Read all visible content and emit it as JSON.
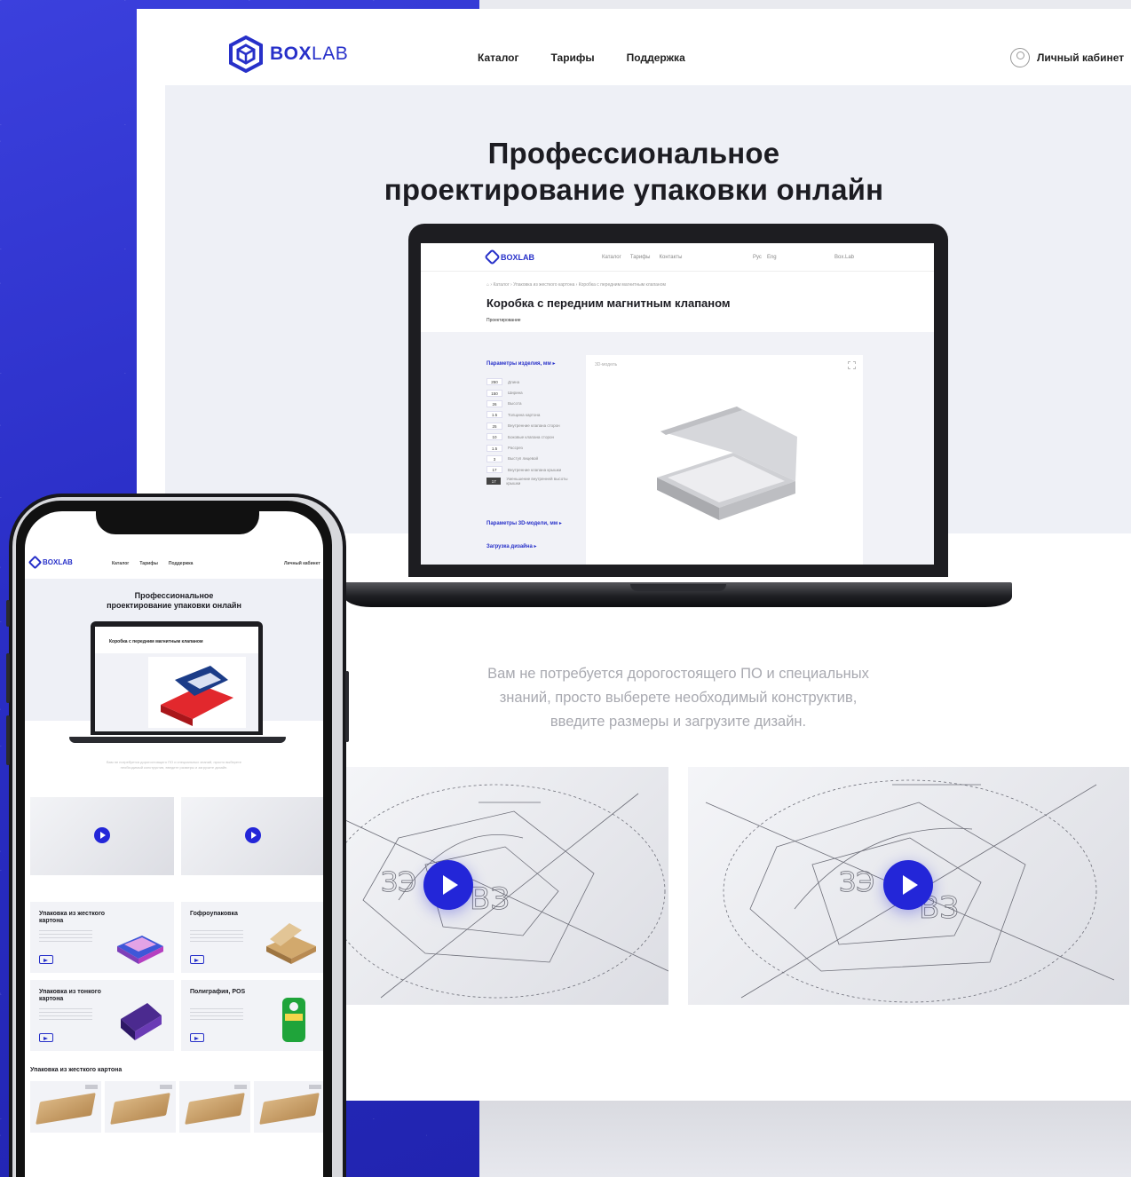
{
  "desktop": {
    "logo": {
      "bold": "BOX",
      "light": "LAB"
    },
    "nav": [
      "Каталог",
      "Тарифы",
      "Поддержка"
    ],
    "account_label": "Личный кабинет",
    "hero_title": "Профессиональное\nпроектирование упаковки онлайн",
    "description": "Вам не потребуется дорогостоящего ПО и специальных\nзнаний, просто выберете необходимый конструктив,\nвведите размеры и загрузите дизайн."
  },
  "laptop_screen": {
    "logo": "BOXLAB",
    "nav": [
      "Каталог",
      "Тарифы",
      "Контакты"
    ],
    "lang": [
      "Рус",
      "Eng"
    ],
    "user": "Box.Lab",
    "breadcrumbs": "⌂  ›  Каталог  ›  Упаковка из жесткого картона  ›  Коробка с передним магнитным клапаном",
    "product_title": "Коробка с передним магнитным клапаном",
    "subtitle": "Проектирование",
    "params_heading": "Параметры изделия, мм ▸",
    "params": [
      {
        "value": "250",
        "label": "Длина"
      },
      {
        "value": "150",
        "label": "Ширина"
      },
      {
        "value": "26",
        "label": "Высота"
      },
      {
        "value": "1.5",
        "label": "Толщина картона"
      },
      {
        "value": "25",
        "label": "Внутренние клапана сторон"
      },
      {
        "value": "10",
        "label": "Боковые клапана сторон"
      },
      {
        "value": "1.5",
        "label": "Рассрез"
      },
      {
        "value": "3",
        "label": "Выступ лицевой"
      },
      {
        "value": "17",
        "label": "Внутренние клапана крышки"
      },
      {
        "value": "17",
        "label": "Уменьшение внутренней высоты крышки"
      }
    ],
    "model_heading": "Параметры 3D-модели, мм ▸",
    "upload_heading": "Загрузка дизайна ▸",
    "viewer_label": "3D-модель"
  },
  "mobile": {
    "logo": "BOXLAB",
    "nav": [
      "Каталог",
      "Тарифы",
      "Поддержка"
    ],
    "account_label": "Личный кабинет",
    "hero_title": "Профессиональное\nпроектирование упаковки онлайн",
    "laptop_title": "Коробка с передним магнитным клапаном",
    "categories": [
      {
        "title": "Упаковка из жесткого картона"
      },
      {
        "title": "Гофроупаковка"
      },
      {
        "title": "Упаковка из тонкого картона"
      },
      {
        "title": "Полиграфия, POS"
      }
    ],
    "section_title": "Упаковка из жесткого картона"
  },
  "colors": {
    "brand": "#2730c9",
    "play": "#2326d8",
    "hero_bg": "#eef0f6"
  }
}
